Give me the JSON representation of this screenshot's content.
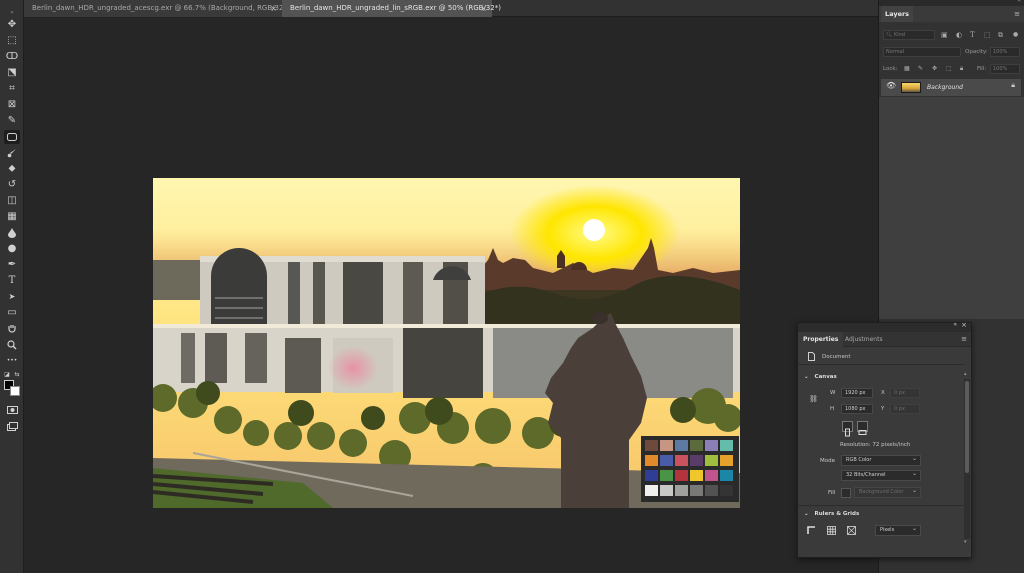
{
  "tabs": [
    {
      "label": "Berlin_dawn_HDR_ungraded_acescg.exr @ 66.7% (Background, RGB/32*) *",
      "close": "×"
    },
    {
      "label": "Berlin_dawn_HDR_ungraded_lin_sRGB.exr @ 50% (RGB/32*)",
      "close": "×"
    }
  ],
  "icons": {
    "move": "✥",
    "marquee": "⬚",
    "lasso": "ↀ",
    "select": "⬔",
    "crop": "⌗",
    "frame": "⊠",
    "eyedropper": "✎",
    "brush": "🖌",
    "stamp": "⬥",
    "history": "↺",
    "eraser": "◫",
    "gradient": "▦",
    "blur": "💧",
    "dodge": "●",
    "pen": "✒",
    "type": "T",
    "path": "➤",
    "rect": "▭",
    "hand": "✋",
    "zoom": "🔍",
    "more": "•••"
  },
  "layers": {
    "title": "Layers",
    "search_placeholder": "Kind",
    "blend_mode": "Normal",
    "opacity_label": "Opacity:",
    "opacity_value": "100%",
    "lock_label": "Lock:",
    "fill_label": "Fill:",
    "fill_value": "100%",
    "layer_name": "Background"
  },
  "properties": {
    "tab_properties": "Properties",
    "tab_adjustments": "Adjustments",
    "document_label": "Document",
    "canvas_title": "Canvas",
    "w_label": "W",
    "w_value": "1920 px",
    "h_label": "H",
    "h_value": "1080 px",
    "x_label": "X",
    "x_value": "0 px",
    "y_label": "Y",
    "y_value": "0 px",
    "resolution": "Resolution: 72 pixels/inch",
    "mode_label": "Mode",
    "mode_value": "RGB Color",
    "depth_value": "32 Bits/Channel",
    "fill_label": "Fill",
    "fill_value": "Background Color",
    "rulers_title": "Rulers & Grids",
    "units_value": "Pixels"
  },
  "colors": {
    "accent_sun": "#fff06a",
    "panel_bg": "#323232",
    "canvas_bg": "#262626"
  }
}
